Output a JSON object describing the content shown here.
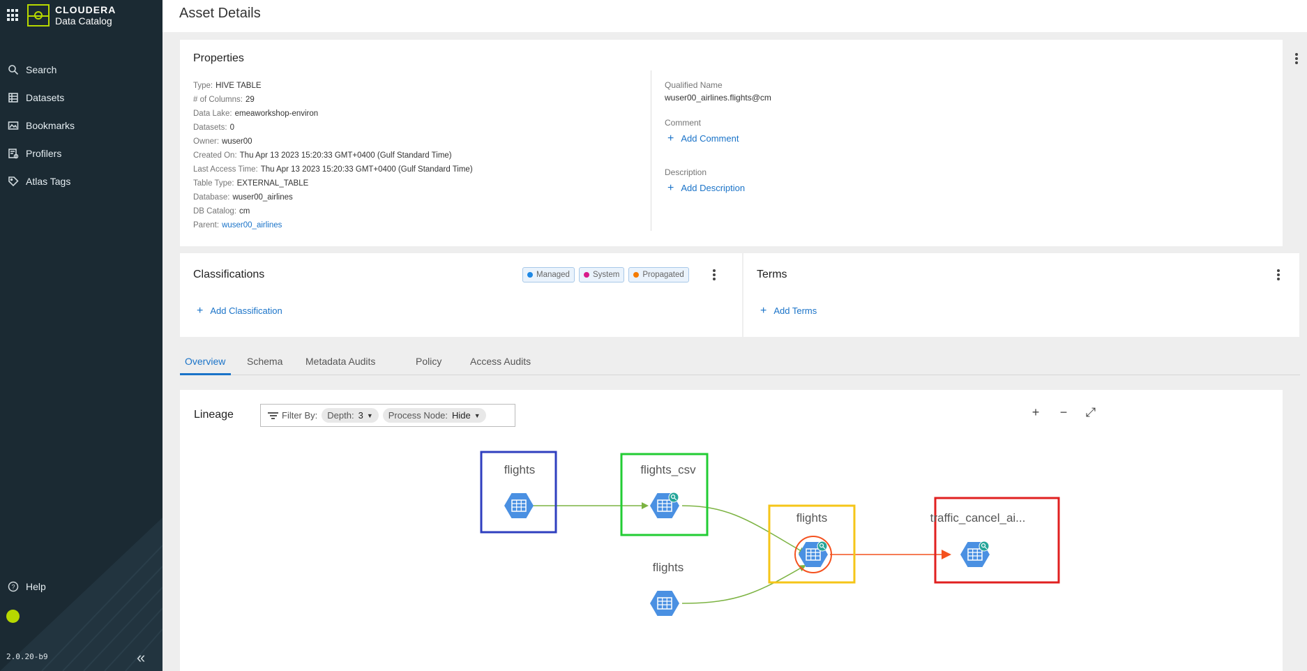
{
  "brand": {
    "line1": "CLOUDERA",
    "line2": "Data Catalog"
  },
  "nav": [
    {
      "label": "Search",
      "icon": "search-icon"
    },
    {
      "label": "Datasets",
      "icon": "datasets-icon"
    },
    {
      "label": "Bookmarks",
      "icon": "bookmarks-icon"
    },
    {
      "label": "Profilers",
      "icon": "profilers-icon"
    },
    {
      "label": "Atlas Tags",
      "icon": "tag-icon"
    }
  ],
  "help": "Help",
  "version": "2.0.20-b9",
  "page": {
    "title": "Asset Details"
  },
  "properties": {
    "title": "Properties",
    "rows": [
      {
        "k": "Type:",
        "v": "HIVE TABLE"
      },
      {
        "k": "# of Columns:",
        "v": "29"
      },
      {
        "k": "Data Lake:",
        "v": "emeaworkshop-environ"
      },
      {
        "k": "Datasets:",
        "v": "0"
      },
      {
        "k": "Owner:",
        "v": "wuser00"
      },
      {
        "k": "Created On:",
        "v": "Thu Apr 13 2023 15:20:33 GMT+0400 (Gulf Standard Time)"
      },
      {
        "k": "Last Access Time:",
        "v": "Thu Apr 13 2023 15:20:33 GMT+0400 (Gulf Standard Time)"
      },
      {
        "k": "Table Type:",
        "v": "EXTERNAL_TABLE"
      },
      {
        "k": "Database:",
        "v": "wuser00_airlines"
      },
      {
        "k": "DB Catalog:",
        "v": "cm"
      },
      {
        "k": "Parent:",
        "v": "wuser00_airlines"
      }
    ],
    "qualified_name_label": "Qualified Name",
    "qualified_name": "wuser00_airlines.flights@cm",
    "comment_label": "Comment",
    "add_comment": "Add Comment",
    "description_label": "Description",
    "add_description": "Add Description"
  },
  "classifications": {
    "title": "Classifications",
    "legend": [
      {
        "label": "Managed",
        "color": "#1e88e5"
      },
      {
        "label": "System",
        "color": "#d81b8a"
      },
      {
        "label": "Propagated",
        "color": "#f57c00"
      }
    ],
    "add": "Add Classification"
  },
  "terms": {
    "title": "Terms",
    "add": "Add Terms"
  },
  "tabs": [
    "Overview",
    "Schema",
    "Metadata Audits",
    "Policy",
    "Access Audits"
  ],
  "active_tab": "Overview",
  "lineage": {
    "title": "Lineage",
    "filter_label": "Filter By:",
    "depth_label": "Depth:",
    "depth_value": "3",
    "process_label": "Process Node:",
    "process_value": "Hide",
    "zoom_in": "+",
    "zoom_out": "−",
    "expand": "⤢",
    "nodes": [
      {
        "id": "n1",
        "label": "flights",
        "frame": "#2f3fbf",
        "badge": false,
        "current": false
      },
      {
        "id": "n2",
        "label": "flights_csv",
        "frame": "#22cc33",
        "badge": true,
        "current": false
      },
      {
        "id": "n3",
        "label": "flights",
        "frame": null,
        "badge": false,
        "current": false
      },
      {
        "id": "n4",
        "label": "flights",
        "frame": "#f5c518",
        "badge": true,
        "current": true
      },
      {
        "id": "n5",
        "label": "traffic_cancel_ai...",
        "frame": "#e02020",
        "badge": true,
        "current": false
      }
    ],
    "edges": [
      {
        "from": "n1",
        "to": "n2",
        "color": "#7cb342"
      },
      {
        "from": "n2",
        "to": "n4",
        "color": "#7cb342"
      },
      {
        "from": "n3",
        "to": "n4",
        "color": "#7cb342"
      },
      {
        "from": "n4",
        "to": "n5",
        "color": "#f4511e"
      }
    ]
  }
}
